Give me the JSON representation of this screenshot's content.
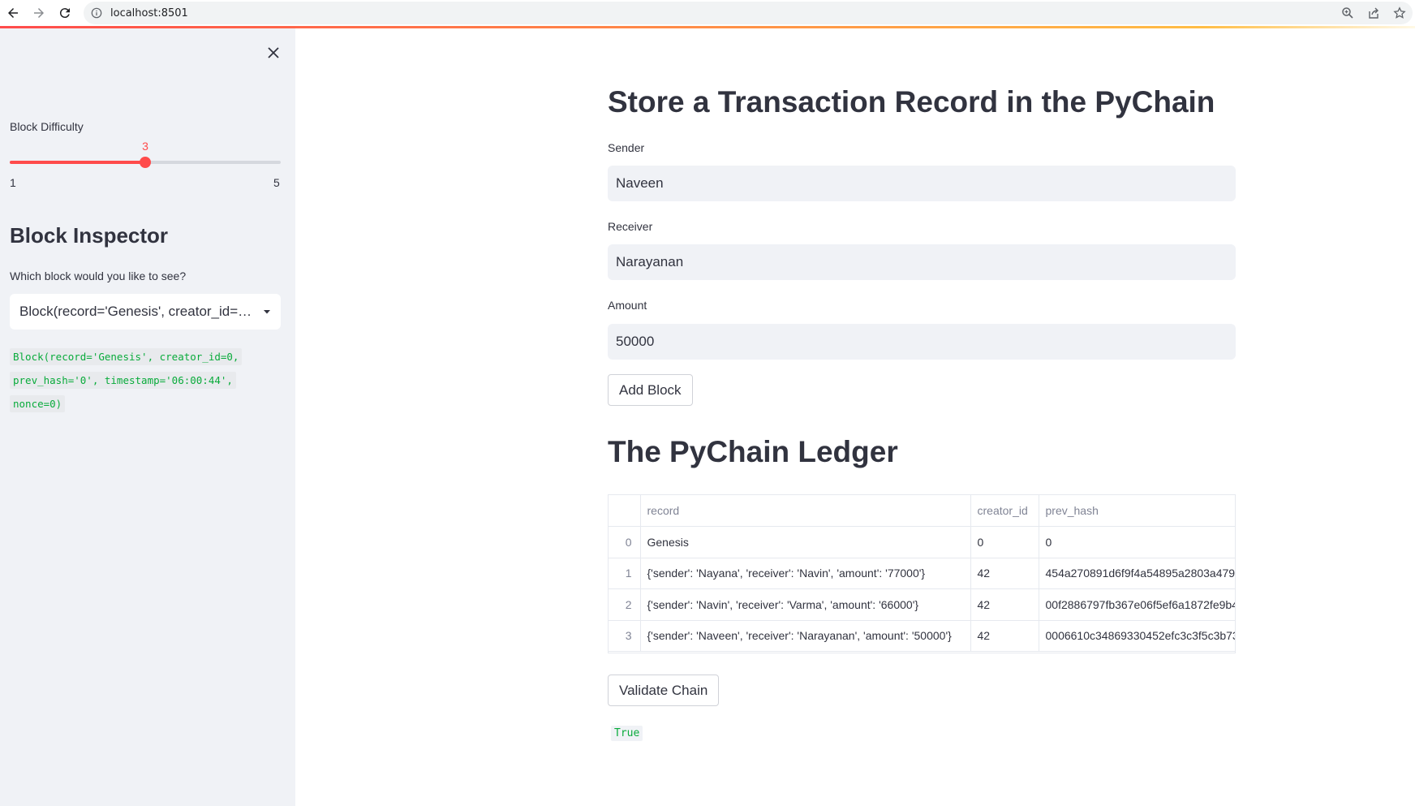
{
  "browser": {
    "url": "localhost:8501"
  },
  "sidebar": {
    "slider": {
      "label": "Block Difficulty",
      "value": 3,
      "value_text": "3",
      "min": 1,
      "max": 5,
      "min_text": "1",
      "max_text": "5"
    },
    "heading": "Block Inspector",
    "select": {
      "label": "Which block would you like to see?",
      "selected": "Block(record='Genesis', creator_id=0, prev_hash='0', timestamp='06:00:44', nonce=0)"
    },
    "code_lines": [
      "Block(record='Genesis', creator_id=0,",
      "prev_hash='0', timestamp='06:00:44',",
      "nonce=0)"
    ]
  },
  "main": {
    "title": "Store a Transaction Record in the PyChain",
    "sender": {
      "label": "Sender",
      "value": "Naveen"
    },
    "receiver": {
      "label": "Receiver",
      "value": "Narayanan"
    },
    "amount": {
      "label": "Amount",
      "value": "50000"
    },
    "add_block_label": "Add Block",
    "ledger_title": "The PyChain Ledger",
    "ledger": {
      "columns": [
        "",
        "record",
        "creator_id",
        "prev_hash"
      ],
      "rows": [
        [
          "0",
          "Genesis",
          "0",
          "0"
        ],
        [
          "1",
          "{'sender': 'Nayana', 'receiver': 'Navin', 'amount': '77000'}",
          "42",
          "454a270891d6f9f4a54895a2803a479"
        ],
        [
          "2",
          "{'sender': 'Navin', 'receiver': 'Varma', 'amount': '66000'}",
          "42",
          "00f2886797fb367e06f5ef6a1872fe9b4"
        ],
        [
          "3",
          "{'sender': 'Naveen', 'receiver': 'Narayanan', 'amount': '50000'}",
          "42",
          "0006610c34869330452efc3c3f5c3b73"
        ]
      ]
    },
    "validate_label": "Validate Chain",
    "validate_result": "True"
  },
  "colors": {
    "accent": "#ff4b4b",
    "sidebar_bg": "#f0f2f6",
    "code_green": "#09ab3b",
    "text": "#31333f"
  }
}
